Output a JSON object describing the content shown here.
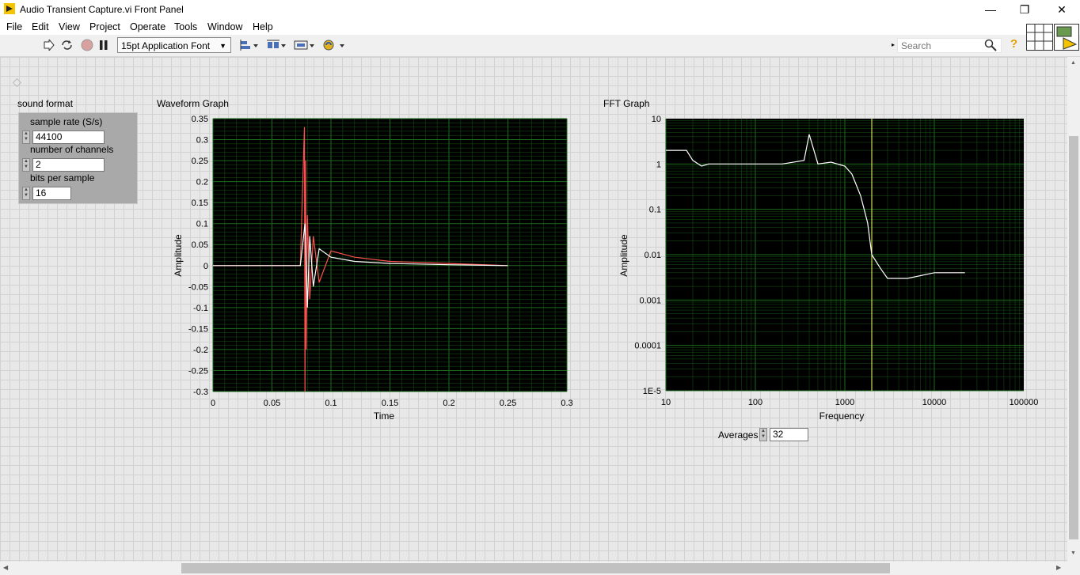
{
  "window": {
    "title": "Audio Transient Capture.vi Front Panel",
    "minimize": "—",
    "restore": "❐",
    "close": "✕"
  },
  "menu": [
    "File",
    "Edit",
    "View",
    "Project",
    "Operate",
    "Tools",
    "Window",
    "Help"
  ],
  "toolbar": {
    "font": "15pt Application Font",
    "search_placeholder": "Search",
    "help": "?"
  },
  "sound_format": {
    "label": "sound format",
    "sample_rate_label": "sample rate (S/s)",
    "sample_rate": "44100",
    "channels_label": "number of channels",
    "channels": "2",
    "bits_label": "bits per sample",
    "bits": "16"
  },
  "waveform_graph": {
    "label": "Waveform Graph",
    "xlabel": "Time",
    "ylabel": "Amplitude",
    "xticks": [
      "0",
      "0.05",
      "0.1",
      "0.15",
      "0.2",
      "0.25",
      "0.3"
    ],
    "yticks": [
      "0.35",
      "0.3",
      "0.25",
      "0.2",
      "0.15",
      "0.1",
      "0.05",
      "0",
      "-0.05",
      "-0.1",
      "-0.15",
      "-0.2",
      "-0.25",
      "-0.3"
    ]
  },
  "fft_graph": {
    "label": "FFT Graph",
    "xlabel": "Frequency",
    "ylabel": "Amplitude",
    "xticks": [
      "10",
      "100",
      "1000",
      "10000",
      "100000"
    ],
    "yticks": [
      "10",
      "1",
      "0.1",
      "0.01",
      "0.001",
      "0.0001",
      "1E-5"
    ]
  },
  "averages": {
    "label": "Averages",
    "value": "32"
  },
  "colors": {
    "plot_bg": "#000000",
    "grid": "#1c6b1c",
    "ch1": "#ff5050",
    "ch2": "#ffffff",
    "cursor": "#ffff66"
  },
  "chart_data": [
    {
      "type": "line",
      "title": "Waveform Graph",
      "xlabel": "Time",
      "ylabel": "Amplitude",
      "xlim": [
        0,
        0.3
      ],
      "ylim": [
        -0.3,
        0.35
      ],
      "grid": true,
      "series": [
        {
          "color": "#ff5050",
          "x": [
            0,
            0.074,
            0.0775,
            0.078,
            0.0785,
            0.079,
            0.08,
            0.082,
            0.085,
            0.09,
            0.1,
            0.12,
            0.15,
            0.2,
            0.25
          ],
          "values": [
            0,
            0,
            0.33,
            -0.3,
            0.25,
            -0.2,
            0.12,
            -0.08,
            0.07,
            -0.04,
            0.035,
            0.02,
            0.01,
            0.005,
            0
          ]
        },
        {
          "color": "#ffffff",
          "x": [
            0,
            0.074,
            0.078,
            0.08,
            0.082,
            0.085,
            0.09,
            0.1,
            0.12,
            0.15,
            0.2,
            0.25
          ],
          "values": [
            0,
            0,
            0.1,
            -0.1,
            0.07,
            -0.05,
            0.04,
            0.02,
            0.01,
            0.005,
            0.002,
            0
          ]
        }
      ]
    },
    {
      "type": "line",
      "title": "FFT Graph",
      "xlabel": "Frequency",
      "ylabel": "Amplitude",
      "xscale": "log",
      "yscale": "log",
      "xlim": [
        10,
        100000
      ],
      "ylim": [
        1e-05,
        10
      ],
      "grid": true,
      "cursor_x": 2000,
      "series": [
        {
          "color": "#ffffff",
          "x": [
            10,
            17,
            20,
            25,
            30,
            50,
            100,
            200,
            350,
            400,
            500,
            700,
            1000,
            1200,
            1500,
            1800,
            2000,
            2500,
            3000,
            5000,
            10000,
            20000,
            22000
          ],
          "values": [
            2,
            2,
            1.2,
            0.9,
            1.0,
            1.0,
            1.0,
            1.0,
            1.2,
            4.5,
            1.0,
            1.1,
            0.9,
            0.6,
            0.2,
            0.05,
            0.01,
            0.005,
            0.003,
            0.003,
            0.004,
            0.004,
            0.004
          ]
        }
      ]
    }
  ]
}
